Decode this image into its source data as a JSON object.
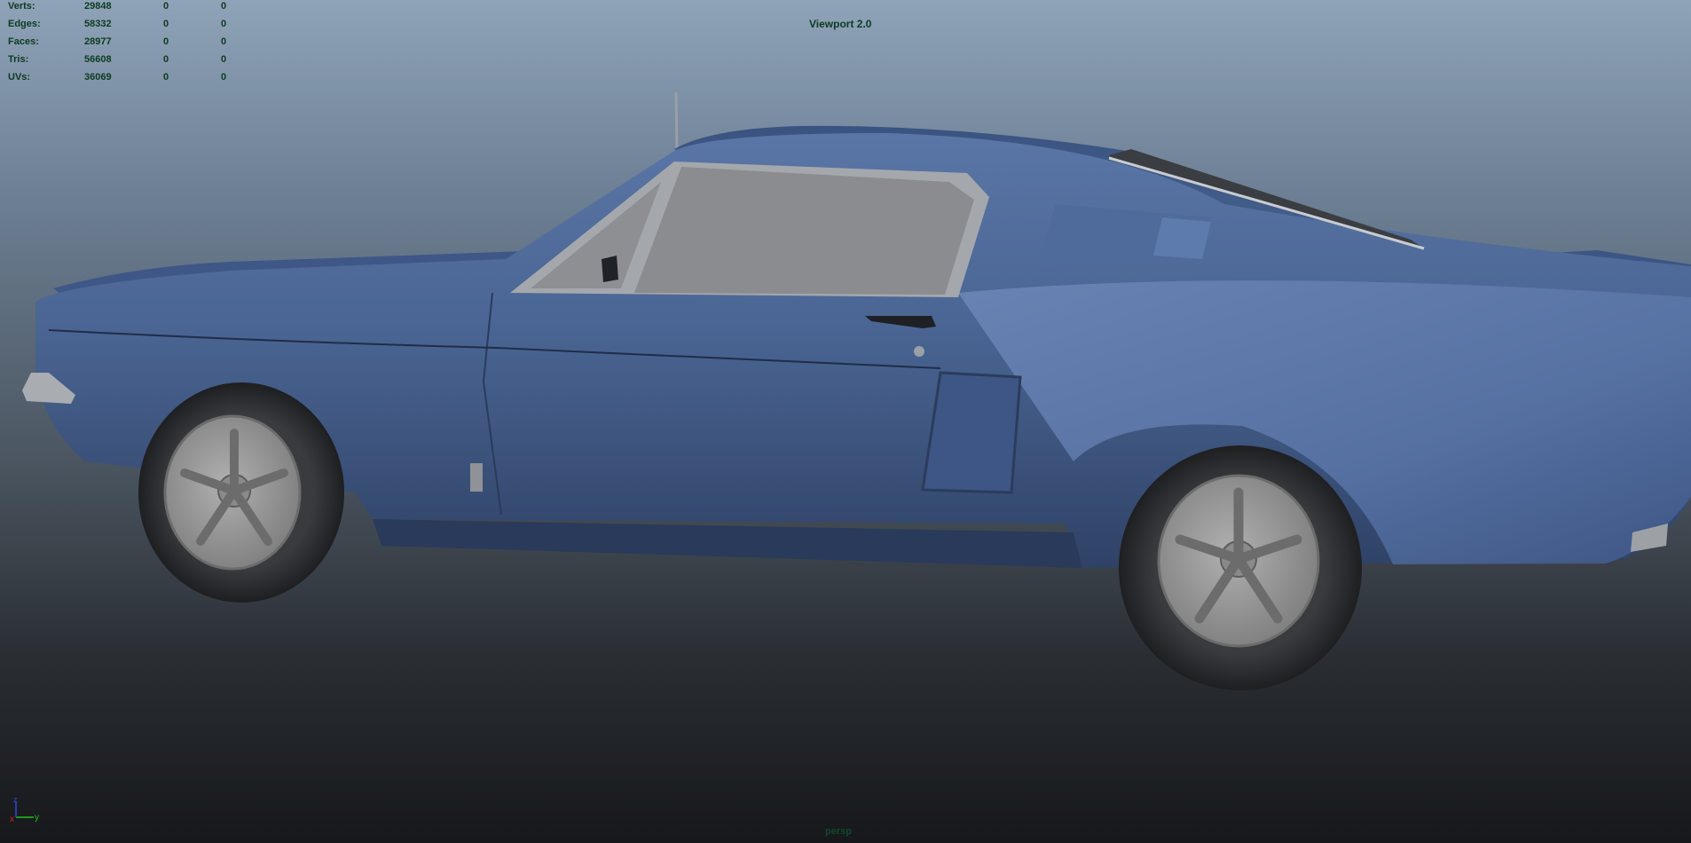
{
  "stats": {
    "rows": [
      {
        "label": "Verts:",
        "v1": "29848",
        "v2": "0",
        "v3": "0"
      },
      {
        "label": "Edges:",
        "v1": "58332",
        "v2": "0",
        "v3": "0"
      },
      {
        "label": "Faces:",
        "v1": "28977",
        "v2": "0",
        "v3": "0"
      },
      {
        "label": "Tris:",
        "v1": "56608",
        "v2": "0",
        "v3": "0"
      },
      {
        "label": "UVs:",
        "v1": "36069",
        "v2": "0",
        "v3": "0"
      }
    ]
  },
  "viewport": {
    "renderer": "Viewport 2.0",
    "camera": "persp"
  },
  "axis": {
    "x_label": "x",
    "y_label": "y",
    "z_label": "z",
    "x_color": "#d02020",
    "y_color": "#20c020",
    "z_color": "#2a4adf"
  },
  "colors": {
    "hud_text": "#0d3a22",
    "car_body": "#4a6593",
    "tire": "#2a2b2e",
    "rim": "#9a9a9a"
  }
}
